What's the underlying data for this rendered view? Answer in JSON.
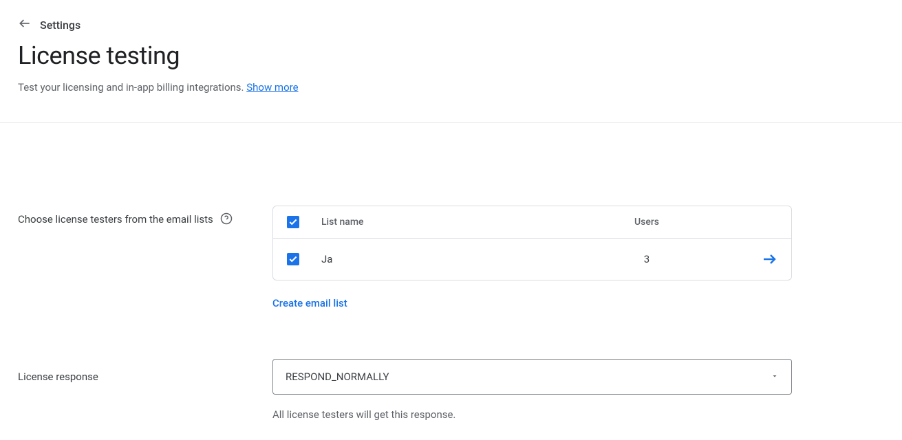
{
  "breadcrumb": {
    "label": "Settings"
  },
  "page": {
    "title": "License testing",
    "subtitle": "Test your licensing and in-app billing integrations.  ",
    "show_more": "Show more"
  },
  "testers_section": {
    "label": "Choose license testers from the email lists",
    "table": {
      "header_name": "List name",
      "header_users": "Users",
      "rows": [
        {
          "name": "Ja",
          "users": "3",
          "checked": true
        }
      ]
    },
    "create_link": "Create email list"
  },
  "response_section": {
    "label": "License response",
    "selected": "RESPOND_NORMALLY",
    "helper": "All license testers will get this response."
  }
}
